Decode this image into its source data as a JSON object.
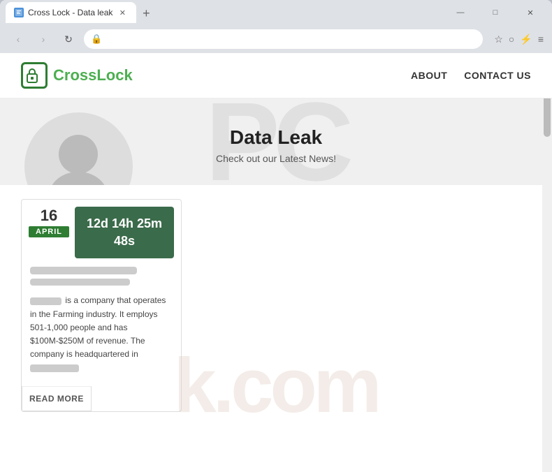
{
  "browser": {
    "tab_title": "Cross Lock - Data leak",
    "tab_favicon": "🔒",
    "url": "",
    "new_tab_icon": "+",
    "window_controls": {
      "minimize": "—",
      "maximize": "□",
      "close": "✕"
    },
    "nav": {
      "back": "‹",
      "forward": "›",
      "refresh": "↻",
      "shield": "🛡"
    }
  },
  "site": {
    "logo_text_1": "Cross",
    "logo_text_2": "Lock",
    "nav_links": [
      {
        "label": "ABOUT"
      },
      {
        "label": "CONTACT US"
      }
    ]
  },
  "hero": {
    "title": "Data Leak",
    "subtitle": "Check out our Latest News!",
    "watermark": "PC"
  },
  "watermark_bottom": "k.com",
  "article": {
    "date_day": "16",
    "date_month": "APRIL",
    "countdown": "12d 14h 25m\n48s",
    "description": "is a company that operates in the Farming industry. It employs 501-1,000 people and has $100M-$250M of revenue. The company is headquartered in",
    "read_more": "READ MORE"
  }
}
